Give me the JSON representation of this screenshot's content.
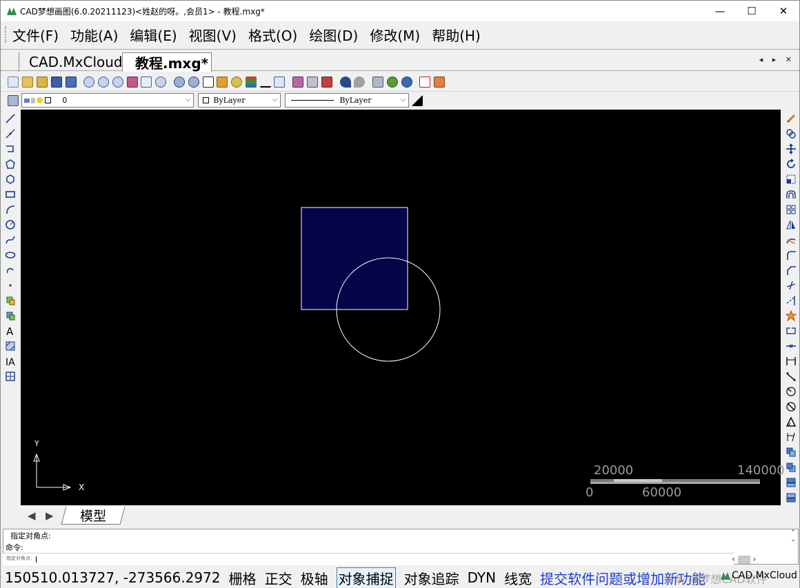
{
  "window": {
    "title": "CAD梦想画图(6.0.20211123)<姓赵的呀。,会员1> - 教程.mxg*",
    "minimize": "—",
    "maximize": "☐",
    "close": "✕"
  },
  "menu": [
    "文件(F)",
    "功能(A)",
    "编辑(E)",
    "视图(V)",
    "格式(O)",
    "绘图(D)",
    "修改(M)",
    "帮助(H)"
  ],
  "tabs": [
    {
      "label": "CAD.MxCloud",
      "active": false
    },
    {
      "label": "教程.mxg*",
      "active": true
    }
  ],
  "tab_nav": "◂ ▸ ✕",
  "properties": {
    "layer": "0",
    "color": "ByLayer",
    "linetype": "ByLayer"
  },
  "canvas": {
    "background": "#000000",
    "rect_fill": "#05054a",
    "stroke": "#ffffff",
    "ucs_y": "Y",
    "ucs_x": "X",
    "scale_labels_top": [
      "20000",
      "140000"
    ],
    "scale_labels_bottom": [
      "0",
      "60000"
    ]
  },
  "model_tab": "模型",
  "model_nav": [
    "◀",
    "▶"
  ],
  "command": {
    "line1": "指定对角点:",
    "line2": "命令:",
    "input_prompt": "指定对角点:"
  },
  "status": {
    "coords": "150510.013727,  -273566.2972",
    "toggles": [
      "栅格",
      "正交",
      "极轴",
      "对象捕捉",
      "对象追踪",
      "DYN",
      "线宽"
    ],
    "active_toggle": "对象捕捉",
    "feedback_link": "提交软件问题或增加新功能",
    "watermark": "头条 @梦想CAD软件",
    "brand": "CAD.MxCloud"
  },
  "icons": {
    "left": [
      "line-icon",
      "construction-line-icon",
      "polyline-icon",
      "polygon-icon",
      "polygon-icon-2",
      "rectangle-icon",
      "arc-icon",
      "circle-icon",
      "spline-icon",
      "ellipse-icon",
      "revcloud-icon",
      "point-icon",
      "block-insert-icon",
      "block-define-icon",
      "text-icon",
      "hatch-icon",
      "mtext-icon",
      "table-icon"
    ],
    "right": [
      "erase-icon",
      "copy-icon",
      "move-icon",
      "rotate-icon",
      "scale-icon",
      "offset-icon",
      "array-icon",
      "mirror-icon",
      "stretch-icon",
      "fillet-icon",
      "chamfer-icon",
      "trim-icon",
      "extend-icon",
      "explode-icon",
      "break-icon",
      "join-icon",
      "dim-linear-icon",
      "dim-aligned-icon",
      "dim-radius-icon",
      "dim-diameter-icon",
      "dim-angle-icon",
      "dim-baseline-icon",
      "draw-order-front-icon",
      "draw-order-back-icon",
      "draw-order-above-icon",
      "draw-order-below-icon"
    ]
  }
}
